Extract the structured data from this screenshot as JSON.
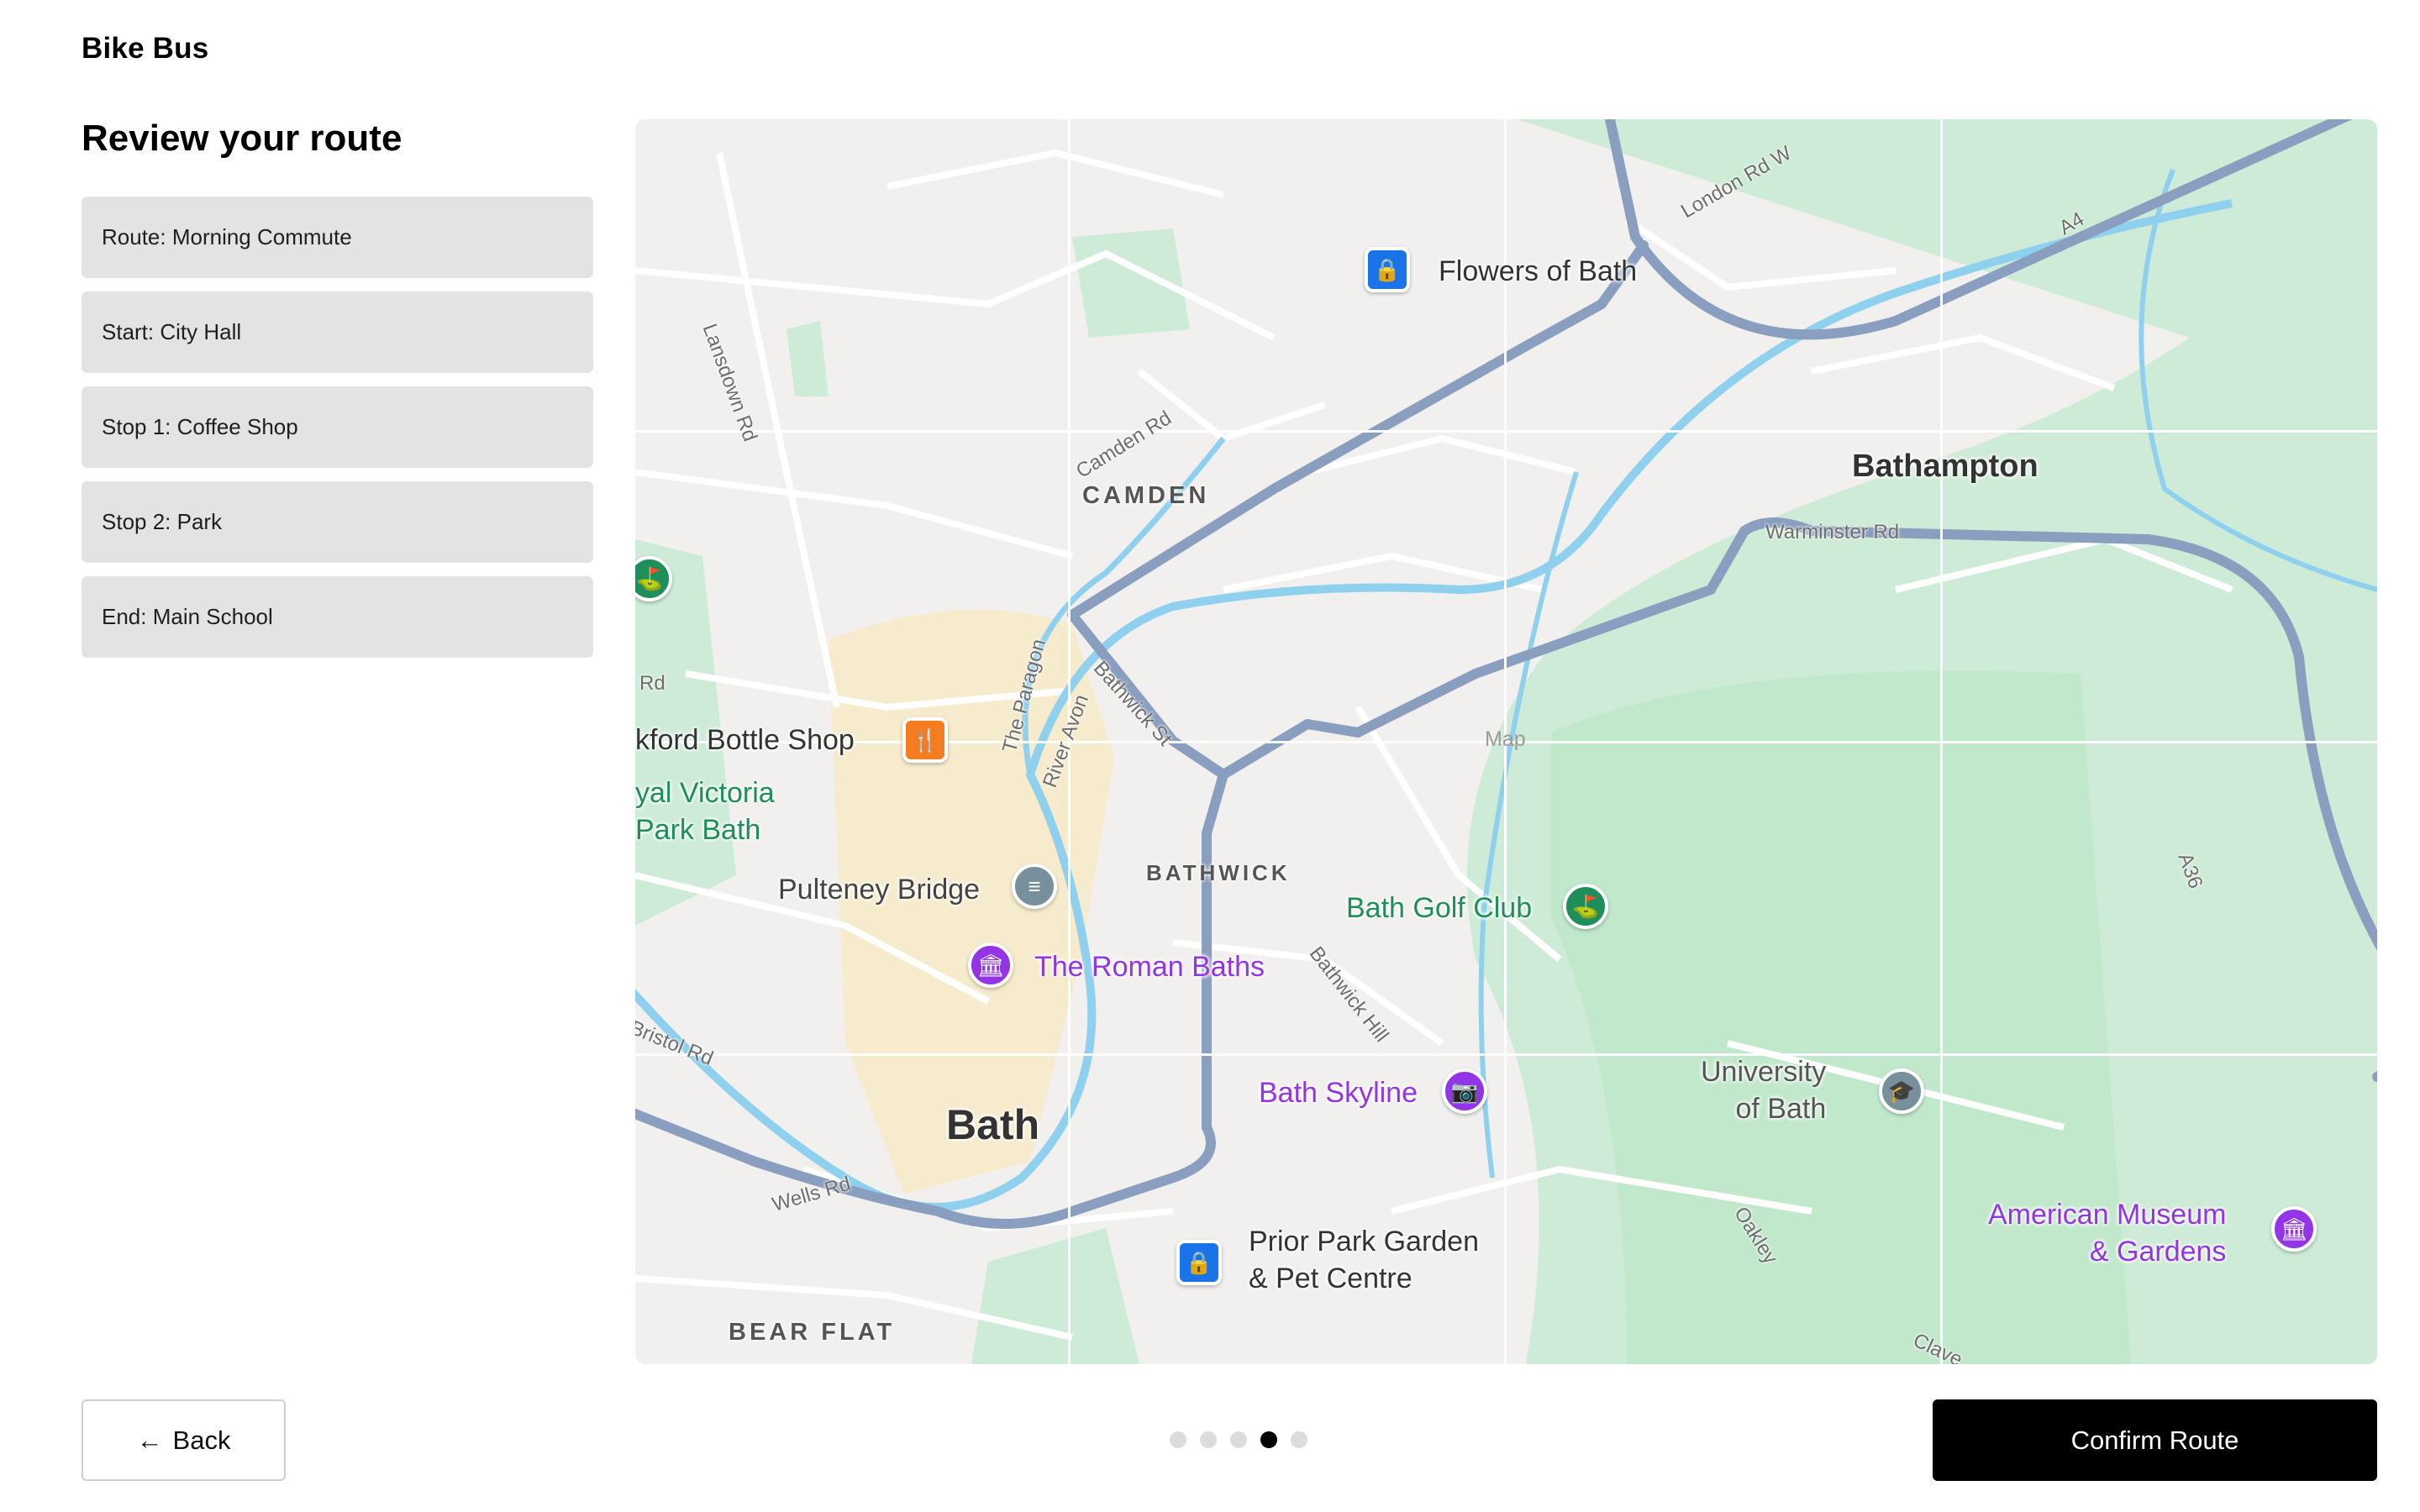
{
  "app": {
    "title": "Bike Bus"
  },
  "page": {
    "heading": "Review your route"
  },
  "route_steps": [
    {
      "label": "Route: Morning Commute"
    },
    {
      "label": "Start: City Hall"
    },
    {
      "label": "Stop 1: Coffee Shop"
    },
    {
      "label": "Stop 2: Park"
    },
    {
      "label": "End: Main School"
    }
  ],
  "map": {
    "watermark": "Map",
    "places": {
      "flowers_of_bath": "Flowers of Bath",
      "bathampton": "Bathampton",
      "bottle_shop": "kford Bottle Shop",
      "victoria_park": "yal Victoria\nPark Bath",
      "pulteney_bridge": "Pulteney Bridge",
      "roman_baths": "The Roman Baths",
      "golf_club": "Bath Golf Club",
      "bath_skyline": "Bath Skyline",
      "university": "University\nof Bath",
      "american_museum": "American Museum\n& Gardens",
      "prior_park": "Prior Park Garden\n& Pet Centre",
      "bath": "Bath"
    },
    "areas": {
      "camden": "CAMDEN",
      "bathwick": "BATHWICK",
      "bear_flat": "BEAR FLAT"
    },
    "streets": {
      "lansdown": "Lansdown Rd",
      "camden_rd": "Camden Rd",
      "london_rd": "London Rd W",
      "a4": "A4",
      "warminster": "Warminster Rd",
      "paragon": "The Paragon",
      "river_avon": "River Avon",
      "bathwick_st": "Bathwick St",
      "bathwick_hill": "Bathwick Hill",
      "bristol_rd": "Bristol Rd",
      "wells_rd": "Wells Rd",
      "oakley": "Oakley",
      "a36": "A36",
      "rd_left": "Rd",
      "claverton": "Clave"
    },
    "colors": {
      "park": "#cdebd6",
      "water": "#8fd0ee",
      "major_road": "#8a9fbf",
      "town": "#f6ebcc",
      "shopping_pin": "#1a73e8",
      "food_pin": "#f57c1f",
      "golf_pin": "#1e8e5a",
      "museum_pin": "#9334e6",
      "landmark_pin": "#78909c"
    }
  },
  "wizard": {
    "total_steps": 5,
    "current_step": 4
  },
  "actions": {
    "back_label": "Back",
    "back_icon": "arrow-left-icon",
    "confirm_label": "Confirm Route"
  }
}
